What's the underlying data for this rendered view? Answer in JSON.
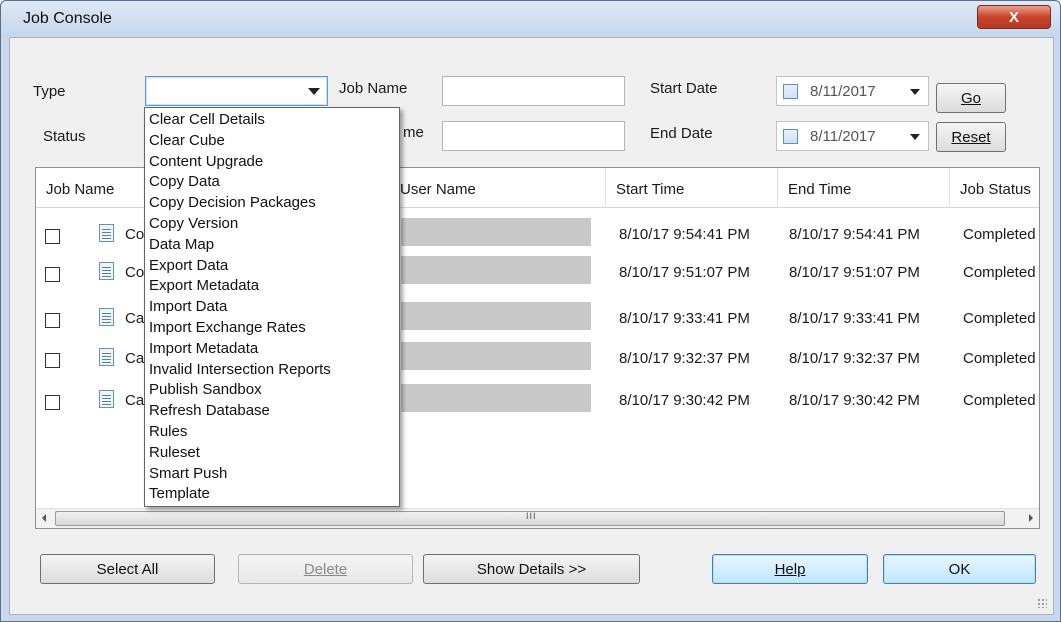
{
  "window": {
    "title": "Job Console",
    "close_glyph": "X"
  },
  "filters": {
    "type_label": "Type",
    "status_label": "Status",
    "job_name_label": "Job Name",
    "user_name_label_partial": "me",
    "start_date_label": "Start Date",
    "end_date_label": "End Date",
    "start_date_value": "8/11/2017",
    "end_date_value": "8/11/2017"
  },
  "buttons": {
    "go": "Go",
    "reset": "Reset",
    "select_all": "Select All",
    "delete": "Delete",
    "show_details": "Show Details >>",
    "help": "Help",
    "ok": "OK"
  },
  "grid": {
    "columns": [
      "Job Name",
      "User Name",
      "Start Time",
      "End Time",
      "Job Status"
    ],
    "rows": [
      {
        "job": "Co",
        "start": "8/10/17 9:54:41 PM",
        "end": "8/10/17 9:54:41 PM",
        "status": "Completed"
      },
      {
        "job": "Co",
        "start": "8/10/17 9:51:07 PM",
        "end": "8/10/17 9:51:07 PM",
        "status": "Completed"
      },
      {
        "job": "Ca",
        "start": "8/10/17 9:33:41 PM",
        "end": "8/10/17 9:33:41 PM",
        "status": "Completed"
      },
      {
        "job": "Ca",
        "start": "8/10/17 9:32:37 PM",
        "end": "8/10/17 9:32:37 PM",
        "status": "Completed"
      },
      {
        "job": "Ca",
        "start": "8/10/17 9:30:42 PM",
        "end": "8/10/17 9:30:42 PM",
        "status": "Completed"
      }
    ],
    "scroll_grip": "III"
  },
  "type_dropdown": {
    "options": [
      "Clear Cell Details",
      "Clear Cube",
      "Content Upgrade",
      "Copy Data",
      "Copy Decision Packages",
      "Copy Version",
      "Data Map",
      "Export Data",
      "Export Metadata",
      "Import Data",
      "Import Exchange Rates",
      "Import Metadata",
      "Invalid Intersection Reports",
      "Publish Sandbox",
      "Refresh Database",
      "Rules",
      "Ruleset",
      "Smart Push",
      "Template"
    ]
  }
}
